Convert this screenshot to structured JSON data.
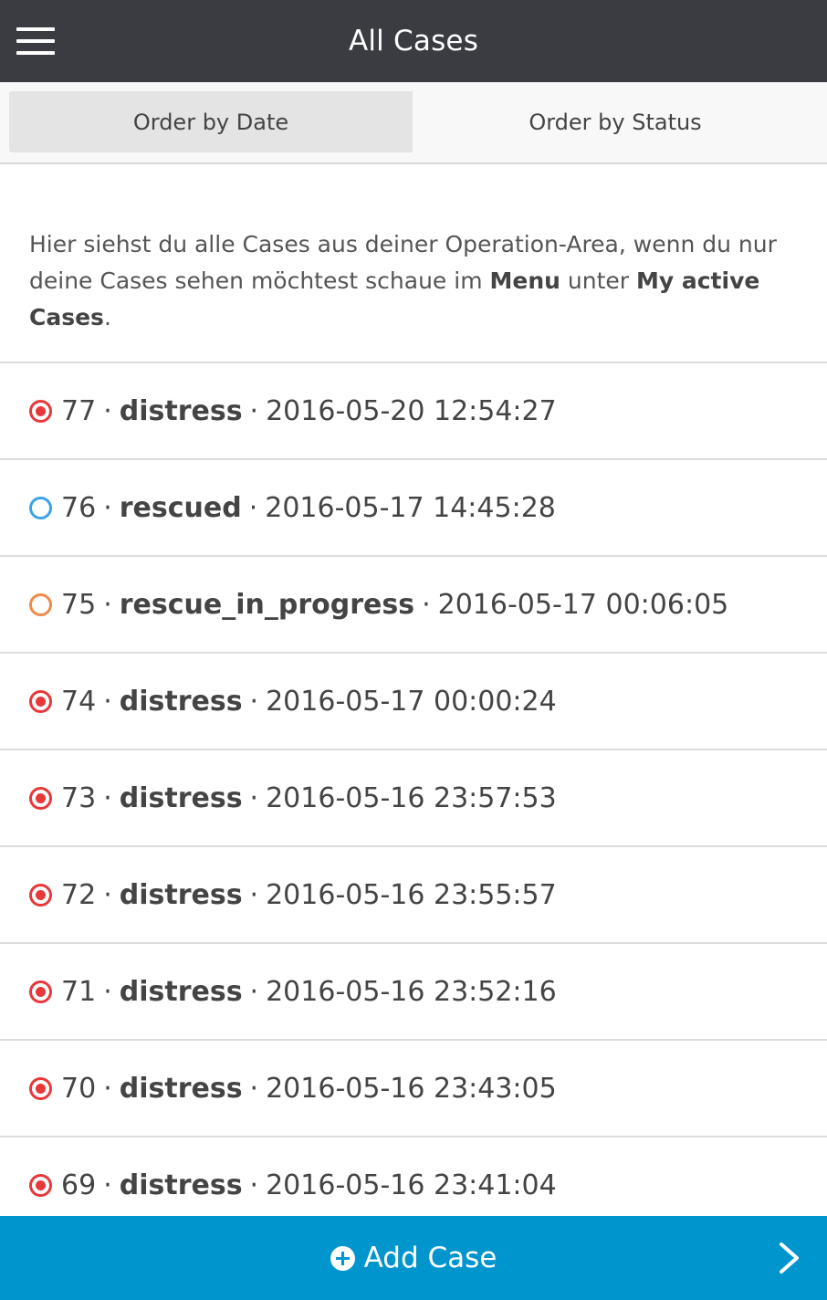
{
  "header": {
    "title": "All Cases",
    "menu_icon": "hamburger-menu-icon"
  },
  "tabs": [
    {
      "label": "Order by Date",
      "active": true
    },
    {
      "label": "Order by Status",
      "active": false
    }
  ],
  "intro": {
    "text_1": "Hier siehst du alle Cases aus deiner Operation-Area, wenn du nur deine Cases sehen möchtest schaue im ",
    "bold_1": "Menu",
    "text_2": " unter ",
    "bold_2": "My active Cases",
    "text_3": "."
  },
  "separator": "·",
  "cases": [
    {
      "id": "77",
      "status": "distress",
      "timestamp": "2016-05-20 12:54:27"
    },
    {
      "id": "76",
      "status": "rescued",
      "timestamp": "2016-05-17 14:45:28"
    },
    {
      "id": "75",
      "status": "rescue_in_progress",
      "timestamp": "2016-05-17 00:06:05"
    },
    {
      "id": "74",
      "status": "distress",
      "timestamp": "2016-05-17 00:00:24"
    },
    {
      "id": "73",
      "status": "distress",
      "timestamp": "2016-05-16 23:57:53"
    },
    {
      "id": "72",
      "status": "distress",
      "timestamp": "2016-05-16 23:55:57"
    },
    {
      "id": "71",
      "status": "distress",
      "timestamp": "2016-05-16 23:52:16"
    },
    {
      "id": "70",
      "status": "distress",
      "timestamp": "2016-05-16 23:43:05"
    },
    {
      "id": "69",
      "status": "distress",
      "timestamp": "2016-05-16 23:41:04"
    }
  ],
  "status_colors": {
    "distress": "#e8383a",
    "rescued": "#3aa4e8",
    "rescue_in_progress": "#f08a4a"
  },
  "footer": {
    "label": "Add Case",
    "add_icon": "plus-circle-icon",
    "next_icon": "chevron-right-icon"
  },
  "colors": {
    "header_bg": "#3a3c42",
    "footer_bg": "#0095cc"
  }
}
